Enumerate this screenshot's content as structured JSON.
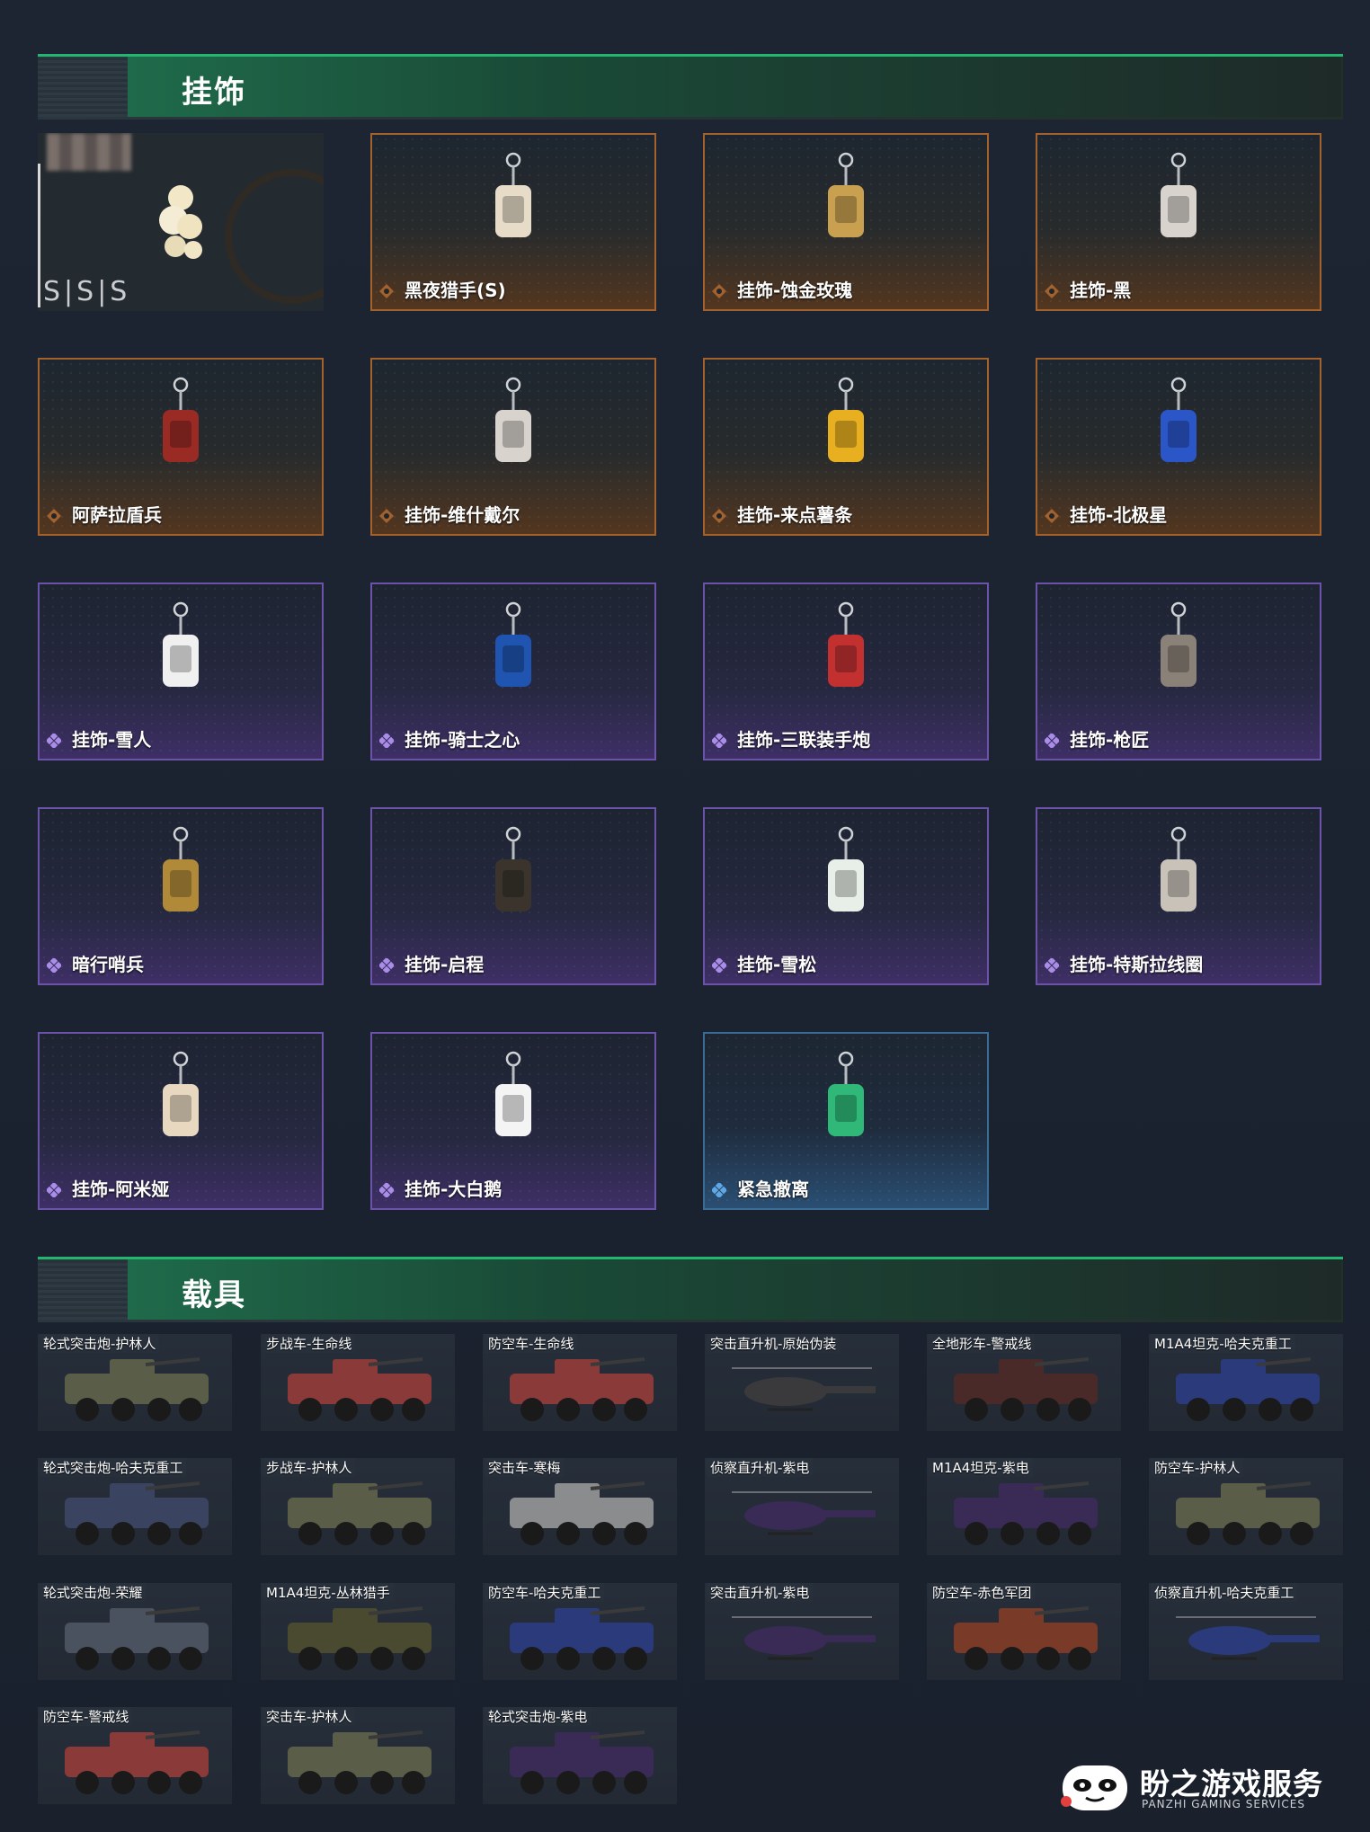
{
  "sections": {
    "charms_title": "挂饰",
    "vehicles_title": "载具"
  },
  "featured": {
    "text": "S|S|S"
  },
  "charms": [
    {
      "label": "黑夜猎手(S)",
      "rarity": "orange"
    },
    {
      "label": "挂饰-蚀金玫瑰",
      "rarity": "orange"
    },
    {
      "label": "挂饰-黑",
      "rarity": "orange"
    },
    {
      "label": "阿萨拉盾兵",
      "rarity": "orange"
    },
    {
      "label": "挂饰-维什戴尔",
      "rarity": "orange"
    },
    {
      "label": "挂饰-来点薯条",
      "rarity": "orange"
    },
    {
      "label": "挂饰-北极星",
      "rarity": "orange"
    },
    {
      "label": "挂饰-雪人",
      "rarity": "purple"
    },
    {
      "label": "挂饰-骑士之心",
      "rarity": "purple"
    },
    {
      "label": "挂饰-三联装手炮",
      "rarity": "purple"
    },
    {
      "label": "挂饰-枪匠",
      "rarity": "purple"
    },
    {
      "label": "暗行哨兵",
      "rarity": "purple"
    },
    {
      "label": "挂饰-启程",
      "rarity": "purple"
    },
    {
      "label": "挂饰-雪松",
      "rarity": "purple"
    },
    {
      "label": "挂饰-特斯拉线圈",
      "rarity": "purple"
    },
    {
      "label": "挂饰-阿米娅",
      "rarity": "purple"
    },
    {
      "label": "挂饰-大白鹅",
      "rarity": "purple"
    },
    {
      "label": "紧急撤离",
      "rarity": "blue"
    }
  ],
  "vehicles": [
    "轮式突击炮-护林人",
    "步战车-生命线",
    "防空车-生命线",
    "突击直升机-原始伪装",
    "全地形车-警戒线",
    "M1A4坦克-哈夫克重工",
    "轮式突击炮-哈夫克重工",
    "步战车-护林人",
    "突击车-寒梅",
    "侦察直升机-紫电",
    "M1A4坦克-紫电",
    "防空车-护林人",
    "轮式突击炮-荣耀",
    "M1A4坦克-丛林猎手",
    "防空车-哈夫克重工",
    "突击直升机-紫电",
    "防空车-赤色军团",
    "侦察直升机-哈夫克重工",
    "防空车-警戒线",
    "突击车-护林人",
    "轮式突击炮-紫电"
  ],
  "colors": {
    "orange": "#a3612c",
    "purple": "#6c52a8",
    "blue": "#3a6d96",
    "accent": "#24b56e"
  },
  "logo": {
    "name": "盼之游戏服务",
    "sub": "PANZHI GAMING SERVICES"
  }
}
